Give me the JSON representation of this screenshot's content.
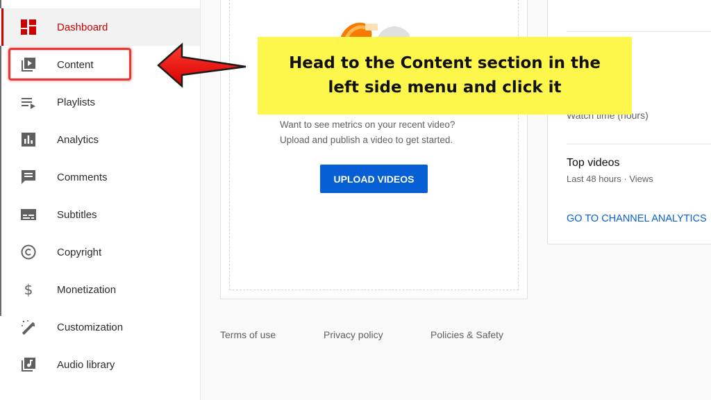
{
  "sidebar": {
    "items": [
      {
        "label": "Dashboard",
        "icon": "dashboard-icon",
        "active": true
      },
      {
        "label": "Content",
        "icon": "content-icon"
      },
      {
        "label": "Playlists",
        "icon": "playlists-icon"
      },
      {
        "label": "Analytics",
        "icon": "analytics-icon"
      },
      {
        "label": "Comments",
        "icon": "comments-icon"
      },
      {
        "label": "Subtitles",
        "icon": "subtitles-icon"
      },
      {
        "label": "Copyright",
        "icon": "copyright-icon"
      },
      {
        "label": "Monetization",
        "icon": "monetization-icon"
      },
      {
        "label": "Customization",
        "icon": "customization-icon"
      },
      {
        "label": "Audio library",
        "icon": "audio-library-icon"
      }
    ]
  },
  "promo": {
    "line1": "Want to see metrics on your recent video?",
    "line2": "Upload and publish a video to get started.",
    "upload_button": "UPLOAD VIDEOS"
  },
  "analytics_card": {
    "stat_label": "Watch time (hours)",
    "top_videos_title": "Top videos",
    "top_videos_sub": "Last 48 hours · Views",
    "link": "GO TO CHANNEL ANALYTICS"
  },
  "footer": {
    "terms": "Terms of use",
    "privacy": "Privacy policy",
    "policies": "Policies & Safety"
  },
  "annotation": {
    "text": "Head to the Content section in the left side menu and click it"
  },
  "colors": {
    "accent_red": "#cc0000",
    "highlight_red": "#e53935",
    "link_blue": "#065fd4",
    "callout_yellow": "#fef74b"
  }
}
